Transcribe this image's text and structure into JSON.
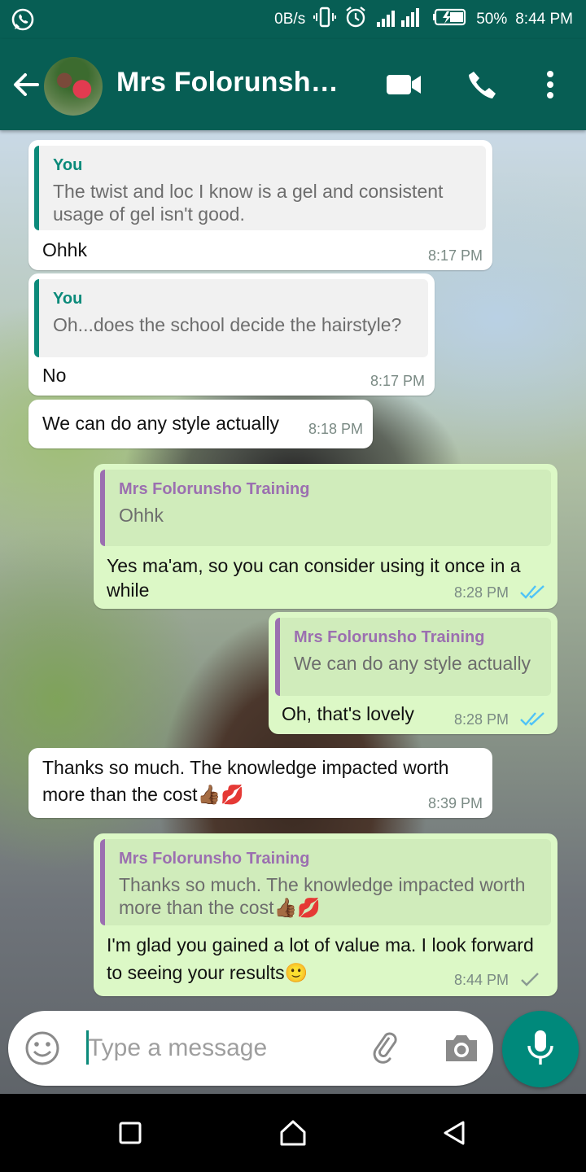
{
  "status_bar": {
    "net_speed": "0B/s",
    "battery": "50%",
    "time": "8:44 PM"
  },
  "header": {
    "title": "Mrs Folorunsho…"
  },
  "messages": [
    {
      "dir": "in",
      "quote_author": "You",
      "quote_text": "The twist and loc I know is a gel and consistent usage of gel isn't good.",
      "text": "Ohhk",
      "time": "8:17 PM"
    },
    {
      "dir": "in",
      "quote_author": "You",
      "quote_text": "Oh...does the school decide the hairstyle?",
      "text": "No",
      "time": "8:17 PM"
    },
    {
      "dir": "in",
      "text": "We can do any style actually",
      "time": "8:18 PM"
    },
    {
      "dir": "out",
      "quote_author": "Mrs Folorunsho Training",
      "quote_text": "Ohhk",
      "text": "Yes ma'am, so you can consider using it once in a while",
      "time": "8:28 PM",
      "status": "read"
    },
    {
      "dir": "out",
      "quote_author": "Mrs Folorunsho Training",
      "quote_text": "We can do any style actually",
      "text": "Oh, that's lovely",
      "time": "8:28 PM",
      "status": "read"
    },
    {
      "dir": "in",
      "text": "Thanks so much. The knowledge impacted worth more than the cost👍🏾💋",
      "time": "8:39 PM"
    },
    {
      "dir": "out",
      "quote_author": "Mrs Folorunsho Training",
      "quote_text": "Thanks so much. The knowledge impacted worth more than the cost👍🏾💋",
      "text": "I'm glad you gained a lot of value ma. I look forward to seeing your results🙂",
      "time": "8:44 PM",
      "status": "sent"
    }
  ],
  "input": {
    "placeholder": "Type a message"
  },
  "colors": {
    "header": "#075e54",
    "outgoing_bubble": "#dcf8c6",
    "incoming_bubble": "#ffffff",
    "read_ticks": "#4fc3f7",
    "fab": "#00897b"
  },
  "icons": [
    "whatsapp-icon",
    "vibrate-icon",
    "alarm-icon",
    "signal-icon",
    "battery-icon",
    "back-arrow-icon",
    "video-call-icon",
    "voice-call-icon",
    "more-vert-icon",
    "emoji-icon",
    "attach-icon",
    "camera-icon",
    "mic-icon",
    "nav-recents-icon",
    "nav-home-icon",
    "nav-back-icon"
  ]
}
